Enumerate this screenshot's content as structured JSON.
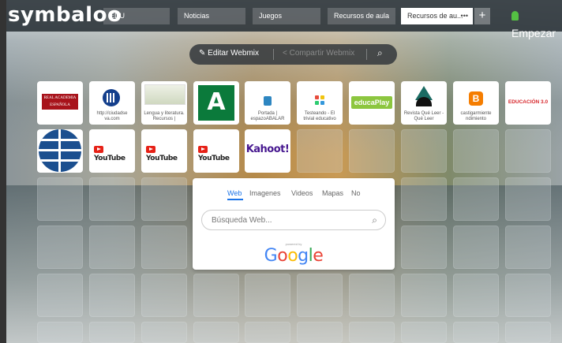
{
  "app": {
    "logo_text": "symbaloo"
  },
  "tabs": [
    {
      "label": "EDU"
    },
    {
      "label": "Noticias"
    },
    {
      "label": "Juegos"
    },
    {
      "label": "Recursos de aula"
    },
    {
      "label": "Recursos de au...",
      "active": true
    }
  ],
  "header": {
    "add_tab": "+",
    "start_label": "Empezar",
    "start_color": "#54c043"
  },
  "toolbar": {
    "edit_label": "Editar Webmix",
    "share_label": "Compartir Webmix"
  },
  "tiles_row1": [
    {
      "label": "",
      "logo_text": "REAL ACADEMIA ESPAÑOLA",
      "icon": "rae-logo"
    },
    {
      "label": "http://ciudadse va.com",
      "icon": "ciudadseva-globe-icon"
    },
    {
      "label": "Lengua y literatura. Recursos |",
      "icon": "lengua-thumbnail"
    },
    {
      "label": "",
      "icon": "junta-andalucia-logo"
    },
    {
      "label": "Portada | espazoABALAR",
      "icon": "abalar-logo"
    },
    {
      "label": "Testeando - El trivial educativo",
      "icon": "testeando-logo"
    },
    {
      "label": "",
      "logo_text": "educaPlay",
      "icon": "educaplay-logo"
    },
    {
      "label": "Revista Qué Leer - Qué Leer",
      "icon": "queleer-logo"
    },
    {
      "label": "castigarmiente ndimiento",
      "icon": "blogger-icon"
    },
    {
      "label": "",
      "logo_text": "EDUCACIÓN 3.0",
      "icon": "educacion30-logo"
    }
  ],
  "tiles_row2": [
    {
      "label": "",
      "icon": "globe-stripes-logo"
    },
    {
      "label": "YouTube",
      "icon": "youtube-logo"
    },
    {
      "label": "YouTube",
      "icon": "youtube-logo"
    },
    {
      "label": "YouTube",
      "icon": "youtube-logo"
    },
    {
      "label": "Kahoot!",
      "icon": "kahoot-logo"
    }
  ],
  "search": {
    "tabs": [
      "Web",
      "Imagenes",
      "Videos",
      "Mapas",
      "No"
    ],
    "placeholder": "Búsqueda Web...",
    "powered_by": "powered by",
    "google_text": "Google"
  },
  "colors": {
    "accent": "#1a73e8",
    "youtube_red": "#e62117",
    "educaplay_green": "#8cc63f",
    "blogger_orange": "#f57d00",
    "junta_green": "#0b7a3b",
    "kahoot_purple": "#46178f"
  }
}
